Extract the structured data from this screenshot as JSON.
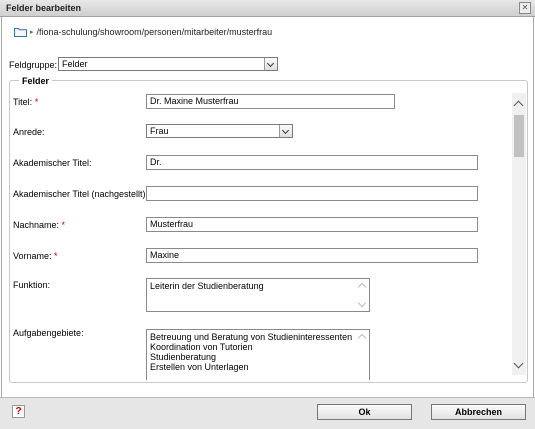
{
  "window": {
    "title": "Felder bearbeiten"
  },
  "path": {
    "text": "/fiona-schulung/showroom/personen/mitarbeiter/musterfrau"
  },
  "feldgruppe": {
    "label": "Feldgruppe:",
    "value": "Felder"
  },
  "fieldset": {
    "legend": "Felder"
  },
  "fields": {
    "titel": {
      "label": "Titel:",
      "required": "*",
      "value": "Dr. Maxine Musterfrau"
    },
    "anrede": {
      "label": "Anrede:",
      "value": "Frau"
    },
    "akad_titel": {
      "label": "Akademischer Titel:",
      "value": "Dr."
    },
    "akad_titel_nach": {
      "label": "Akademischer Titel (nachgestellt):",
      "value": ""
    },
    "nachname": {
      "label": "Nachname:",
      "required": "*",
      "value": "Musterfrau"
    },
    "vorname": {
      "label": "Vorname:",
      "required": "*",
      "value": "Maxine"
    },
    "funktion": {
      "label": "Funktion:",
      "value": "Leiterin der Studienberatung"
    },
    "aufgaben": {
      "label": "Aufgabengebiete:",
      "lines": [
        "Betreuung und Beratung von Studieninteressenten",
        "Koordination von Tutorien",
        "Studienberatung",
        "Erstellen von Unterlagen"
      ]
    }
  },
  "buttons": {
    "ok": "Ok",
    "cancel": "Abbrechen",
    "help": "?"
  }
}
